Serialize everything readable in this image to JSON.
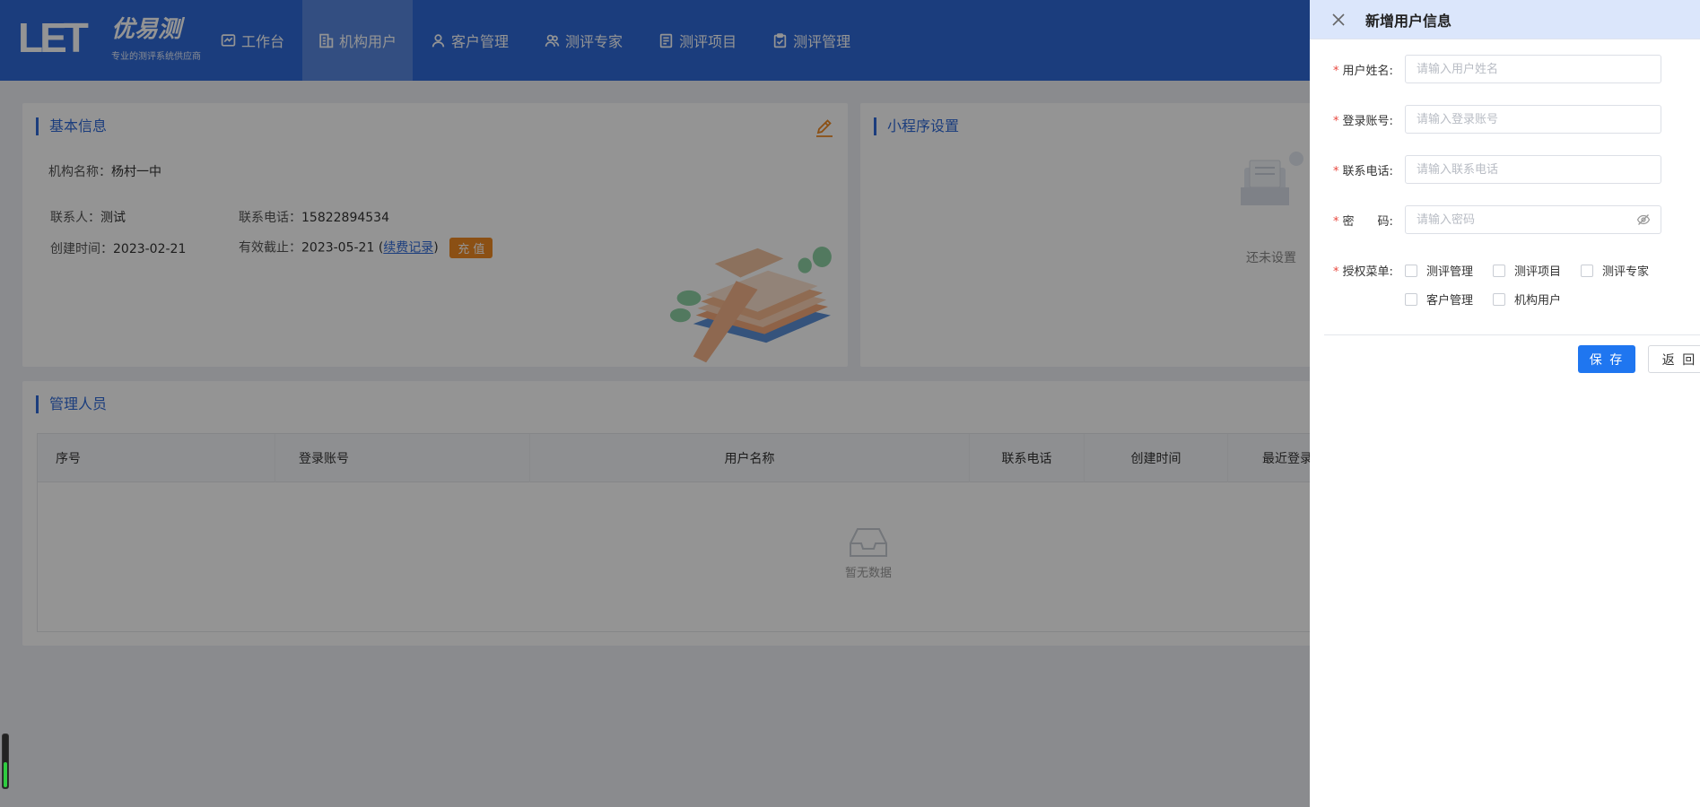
{
  "brand": {
    "mark": "LET",
    "name": "优易测",
    "sub": "专业的测评系统供应商"
  },
  "nav": [
    {
      "label": "工作台",
      "icon": "dashboard-icon",
      "active": false
    },
    {
      "label": "机构用户",
      "icon": "building-icon",
      "active": true
    },
    {
      "label": "客户管理",
      "icon": "user-icon",
      "active": false
    },
    {
      "label": "测评专家",
      "icon": "users-icon",
      "active": false
    },
    {
      "label": "测评项目",
      "icon": "document-icon",
      "active": false
    },
    {
      "label": "测评管理",
      "icon": "clipboard-check-icon",
      "active": false
    }
  ],
  "basic_info": {
    "title": "基本信息",
    "org_label": "机构名称：",
    "org_value": "杨村一中",
    "contact_label": "联系人：",
    "contact_value": "测试",
    "phone_label": "联系电话：",
    "phone_value": "15822894534",
    "created_label": "创建时间：",
    "created_value": "2023-02-21",
    "expiry_label": "有效截止：",
    "expiry_value": "2023-05-21",
    "renewal_open": " (",
    "renewal_link": "续费记录",
    "renewal_close": ")",
    "recharge_label": "充 值"
  },
  "mini_program": {
    "title": "小程序设置",
    "empty_text": "还未设置"
  },
  "managers": {
    "title": "管理人员",
    "columns": [
      "序号",
      "登录账号",
      "用户名称",
      "联系电话",
      "创建时间",
      "最近登录"
    ],
    "rows": [],
    "empty_text": "暂无数据"
  },
  "drawer": {
    "title": "新增用户信息",
    "fields": [
      {
        "label": "用户姓名:",
        "placeholder": "请输入用户姓名",
        "value": ""
      },
      {
        "label": "登录账号:",
        "placeholder": "请输入登录账号",
        "value": ""
      },
      {
        "label": "联系电话:",
        "placeholder": "请输入联系电话",
        "value": ""
      },
      {
        "label": "密　　码:",
        "placeholder": "请输入密码",
        "value": ""
      }
    ],
    "menu_label": "授权菜单:",
    "menus": [
      {
        "label": "测评管理",
        "checked": false
      },
      {
        "label": "测评项目",
        "checked": false
      },
      {
        "label": "测评专家",
        "checked": false
      },
      {
        "label": "客户管理",
        "checked": false
      },
      {
        "label": "机构用户",
        "checked": false
      }
    ],
    "save_label": "保 存",
    "back_label": "返 回"
  },
  "colors": {
    "primary": "#2f6ad8",
    "button": "#1f76f0",
    "accent": "#f08a24",
    "required": "#e8483f"
  }
}
